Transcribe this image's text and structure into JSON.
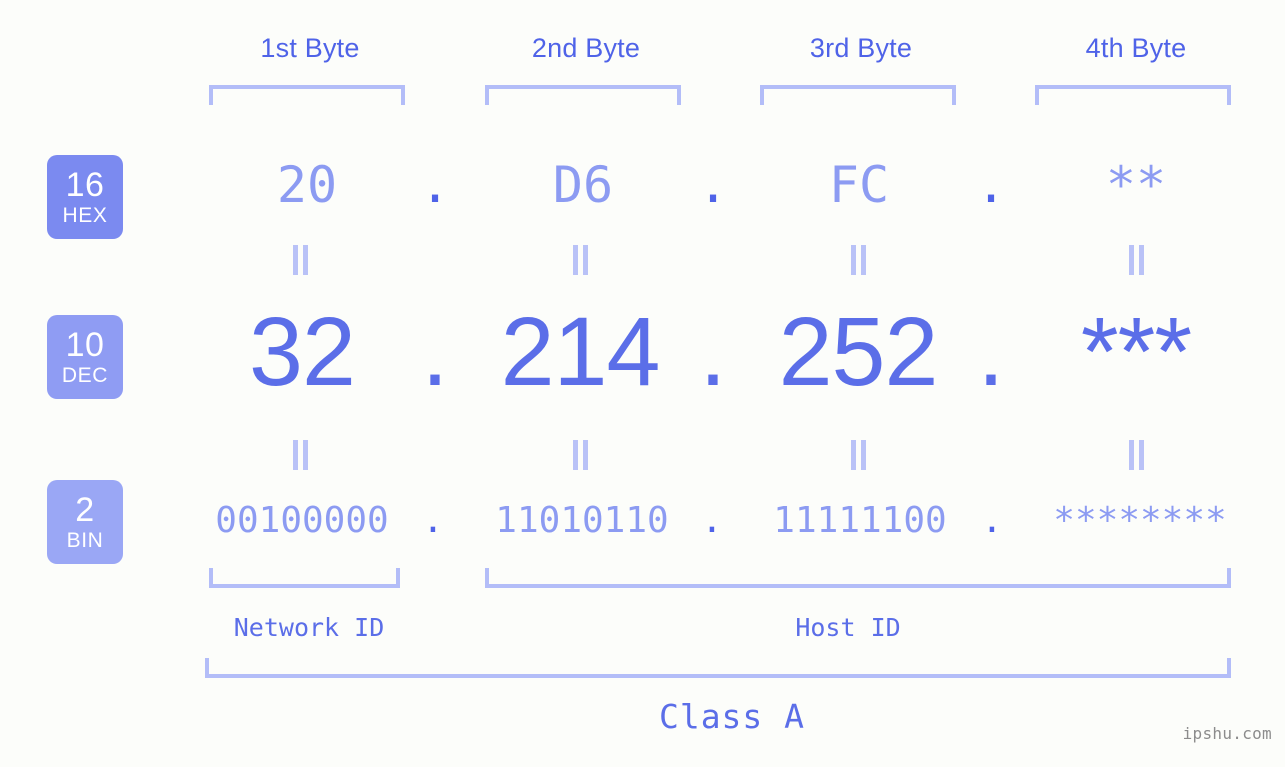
{
  "background_color": "#fcfdfa",
  "accent_color": "#5b6ee8",
  "accent_light_color": "#8c9bf2",
  "bracket_color": "#b3bdf8",
  "header": {
    "byte_labels": [
      {
        "label": "1st Byte"
      },
      {
        "label": "2nd Byte"
      },
      {
        "label": "3rd Byte"
      },
      {
        "label": "4th Byte"
      }
    ]
  },
  "bases": [
    {
      "number": "16",
      "abbr": "HEX",
      "color": "#7b8af0"
    },
    {
      "number": "10",
      "abbr": "DEC",
      "color": "#8f9cf3"
    },
    {
      "number": "2",
      "abbr": "BIN",
      "color": "#9aa7f5"
    }
  ],
  "rows": {
    "hex": {
      "values": [
        "20",
        "D6",
        "FC",
        "**"
      ],
      "separator": "."
    },
    "dec": {
      "values": [
        "32",
        "214",
        "252",
        "***"
      ],
      "separator": "."
    },
    "bin": {
      "values": [
        "00100000",
        "11010110",
        "11111100",
        "********"
      ],
      "separator": "."
    }
  },
  "equality_symbol": "=",
  "footer": {
    "network_id_label": "Network ID",
    "host_id_label": "Host ID",
    "class_label": "Class A",
    "watermark": "ipshu.com"
  }
}
